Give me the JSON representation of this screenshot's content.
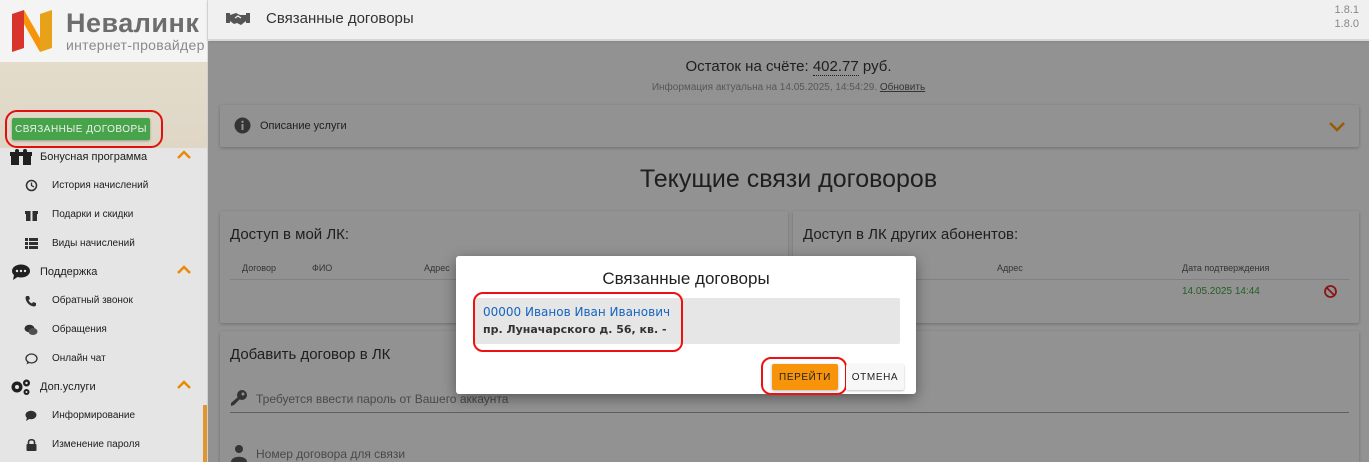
{
  "brand": {
    "name": "Невалинк",
    "tagline": "интернет-провайдер",
    "colors": {
      "orange": "#f7940a",
      "red": "#d9342b",
      "green": "#4caf50"
    }
  },
  "sidebar": {
    "linked_contracts_button": "СВЯЗАННЫЕ ДОГОВОРЫ",
    "groups": [
      {
        "label": "Бонусная программа",
        "icon": "gift-icon",
        "expanded": true,
        "items": [
          {
            "label": "История начислений",
            "icon": "history-icon"
          },
          {
            "label": "Подарки и скидки",
            "icon": "gift-small-icon"
          },
          {
            "label": "Виды начислений",
            "icon": "list-icon"
          }
        ]
      },
      {
        "label": "Поддержка",
        "icon": "chat-icon",
        "expanded": true,
        "items": [
          {
            "label": "Обратный звонок",
            "icon": "phone-icon"
          },
          {
            "label": "Обращения",
            "icon": "comments-icon"
          },
          {
            "label": "Онлайн чат",
            "icon": "chat-bubble-icon"
          }
        ]
      },
      {
        "label": "Доп.услуги",
        "icon": "gears-icon",
        "expanded": true,
        "items": [
          {
            "label": "Информирование",
            "icon": "message-icon"
          },
          {
            "label": "Изменение пароля",
            "icon": "lock-icon"
          }
        ]
      }
    ]
  },
  "topbar": {
    "title": "Связанные договоры",
    "icon": "handshake-icon",
    "version_line1": "1.8.1",
    "version_line2": "1.8.0"
  },
  "main": {
    "balance_prefix": "Остаток на счёте:",
    "balance_amount": "402.77",
    "balance_currency": "руб.",
    "info_text": "Информация актуальна на 14.05.2025, 14:54:29.",
    "refresh_link": "Обновить",
    "service_description": "Описание услуги",
    "section_title": "Текущие связи договоров",
    "my_access": {
      "title": "Доступ в мой ЛК:",
      "columns": [
        "Договор",
        "ФИО",
        "Адрес"
      ]
    },
    "others_access": {
      "title": "Доступ в ЛК других абонентов:",
      "columns": [
        "Адрес",
        "Дата подтверждения"
      ],
      "rows": [
        {
          "date": "14.05.2025 14:44"
        }
      ]
    },
    "add_contract": {
      "title": "Добавить договор в ЛК",
      "password_hint": "Требуется ввести пароль от Вашего аккаунта",
      "contract_placeholder": "Номер договора для связи"
    }
  },
  "modal": {
    "title": "Связанные договоры",
    "contract_line": "00000 Иванов Иван Иванович",
    "address_line": "пр. Луначарского д. 56, кв. -",
    "go_button": "ПЕРЕЙТИ",
    "cancel_button": "ОТМЕНА"
  }
}
